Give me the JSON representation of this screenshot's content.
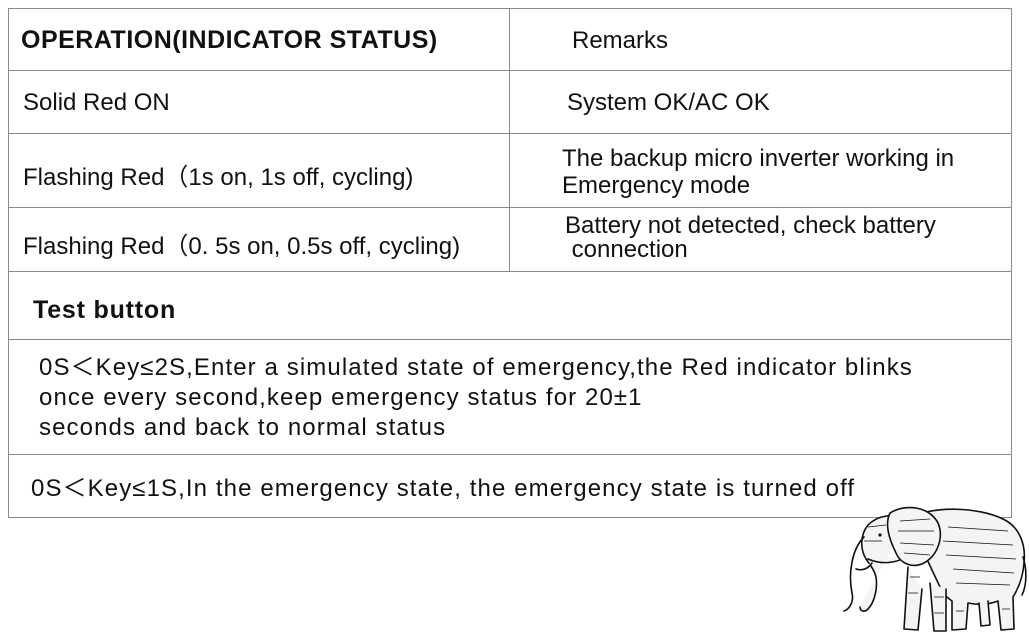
{
  "table": {
    "header": {
      "operation": "OPERATION(INDICATOR STATUS)",
      "remarks": "Remarks"
    },
    "rows": [
      {
        "operation": "Solid Red  ON",
        "remarks": [
          "System OK/AC OK"
        ]
      },
      {
        "operation": "Flashing Red（1s on, 1s off, cycling)",
        "remarks": [
          "The backup micro inverter working in",
          "Emergency mode"
        ]
      },
      {
        "operation": "Flashing Red（0. 5s on, 0.5s off, cycling)",
        "remarks": [
          "Battery not detected, check battery",
          " connection"
        ]
      }
    ],
    "test_button": {
      "title": "Test button",
      "desc1": [
        "0S＜Key≤2S,Enter a simulated state of emergency,the Red indicator blinks",
        "once every second,keep emergency status for 20±1",
        "seconds and back to normal status"
      ],
      "desc2": "0S＜Key≤1S,In the emergency state, the emergency state is turned off"
    }
  }
}
